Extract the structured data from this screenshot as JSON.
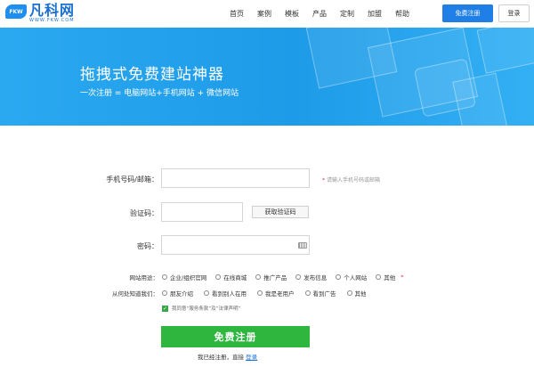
{
  "header": {
    "logo_badge": "FKW",
    "logo_name": "凡科网",
    "logo_url": "WWW.FKW.COM",
    "nav": [
      "首页",
      "案例",
      "模板",
      "产品",
      "定制",
      "加盟",
      "帮助"
    ],
    "register_label": "免费注册",
    "login_label": "登录"
  },
  "banner": {
    "title": "拖拽式免费建站神器",
    "subtitle": "一次注册 = 电脑网站+手机网站 + 微信网站"
  },
  "form": {
    "phone_label": "手机号码/邮箱：",
    "phone_hint": "请输入手机号码或邮箱",
    "code_label": "验证码：",
    "get_code_label": "获取验证码",
    "password_label": "密码：",
    "purpose_label": "网站用途：",
    "purpose_options": [
      "企业/组织官网",
      "在线商城",
      "推广产品",
      "发布信息",
      "个人网站",
      "其他"
    ],
    "source_label": "从何处知道我们：",
    "source_options": [
      "朋友介绍",
      "看到别人在用",
      "我是老用户",
      "看到广告",
      "其他"
    ],
    "required_mark": "*",
    "agree_text": "我同意“服务条款”及“法律声明”",
    "submit_label": "免费注册",
    "login_prompt": "我已经注册，直接",
    "login_link": "登录"
  },
  "colors": {
    "primary": "#1f7fe6",
    "banner": "#1e9be8",
    "submit": "#2fb63f",
    "required": "#e4393c"
  }
}
